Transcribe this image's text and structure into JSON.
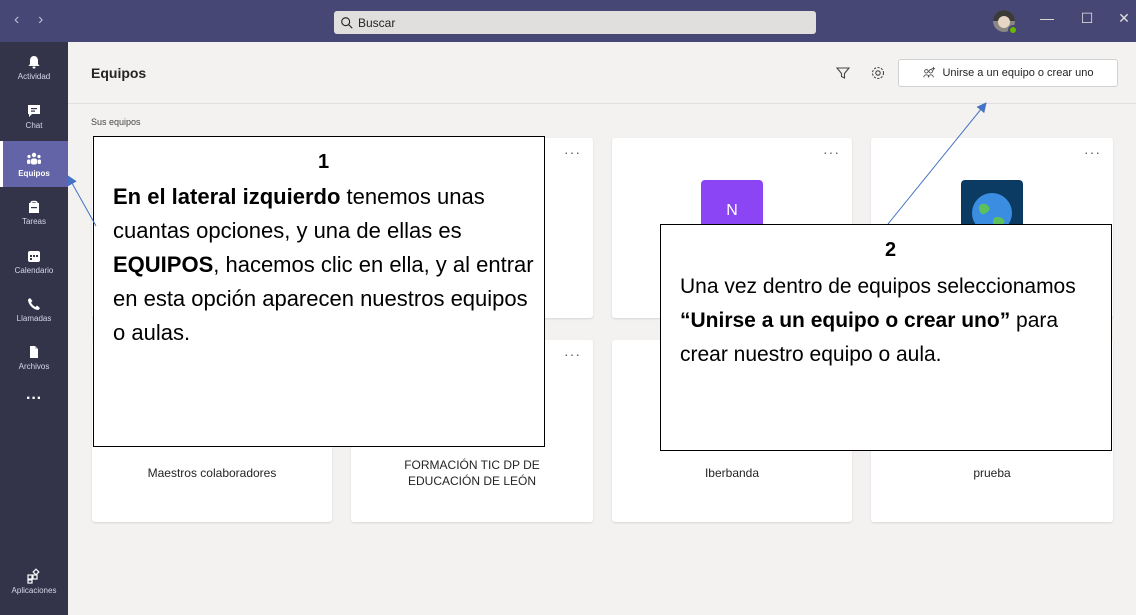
{
  "titlebar": {
    "back_arrow": "‹",
    "forward_arrow": "›",
    "search_placeholder": "Buscar",
    "minimize": "—",
    "maximize": "☐",
    "close": "✕"
  },
  "rail": {
    "items": [
      {
        "label": "Actividad",
        "icon": "bell-icon"
      },
      {
        "label": "Chat",
        "icon": "chat-icon"
      },
      {
        "label": "Equipos",
        "icon": "teams-icon",
        "active": true
      },
      {
        "label": "Tareas",
        "icon": "assignments-icon"
      },
      {
        "label": "Calendario",
        "icon": "calendar-icon"
      },
      {
        "label": "Llamadas",
        "icon": "phone-icon"
      },
      {
        "label": "Archivos",
        "icon": "files-icon"
      }
    ],
    "more": "···",
    "apps_label": "Aplicaciones"
  },
  "header": {
    "title": "Equipos",
    "join_button": "Unirse a un equipo o crear uno"
  },
  "section_label": "Sus equipos",
  "cards": [
    {
      "name": "Maestros colaboradores",
      "more": "···"
    },
    {
      "name_line1": "FORMACIÓN TIC DP DE",
      "name_line2": "EDUCACIÓN DE LEÓN",
      "more": "···"
    },
    {
      "name": "Iberbanda",
      "more": "···",
      "tile_letter": "N",
      "tile_color": "#8b45f5"
    },
    {
      "name": "prueba",
      "more": "···",
      "tile_color": "#0b3b63"
    }
  ],
  "callout1": {
    "number": "1",
    "bold1": "En el lateral izquierdo",
    "text1": " tenemos unas cuantas opciones, y una de ellas es ",
    "bold2": "EQUIPOS",
    "text2": ", hacemos clic en ella, y al entrar en esta opción aparecen nuestros equipos o aulas."
  },
  "callout2": {
    "number": "2",
    "text1": "Una vez dentro de equipos seleccionamos ",
    "bold1": "“Unirse a un equipo o crear uno”",
    "text2": " para crear nuestro equipo o aula."
  },
  "colors": {
    "titlebar": "#464775",
    "rail": "#33344a",
    "rail_active": "#6264a7",
    "arrow": "#4472c4"
  }
}
